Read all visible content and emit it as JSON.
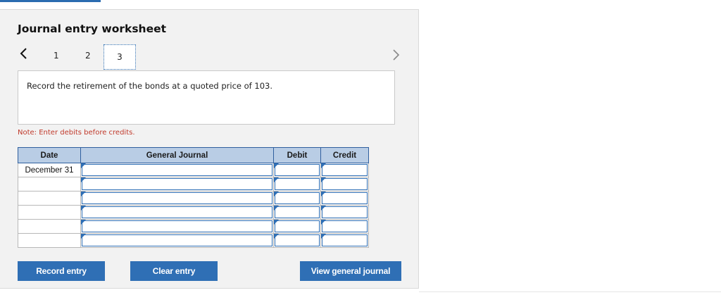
{
  "title": "Journal entry worksheet",
  "pagination": {
    "pages": [
      "1",
      "2",
      "3"
    ],
    "current": "3"
  },
  "instruction": "Record the retirement of the bonds at a quoted price of 103.",
  "note": "Note: Enter debits before credits.",
  "table": {
    "headers": {
      "date": "Date",
      "journal": "General Journal",
      "debit": "Debit",
      "credit": "Credit"
    },
    "rows": [
      {
        "date": "December 31",
        "journal": "",
        "debit": "",
        "credit": ""
      },
      {
        "date": "",
        "journal": "",
        "debit": "",
        "credit": ""
      },
      {
        "date": "",
        "journal": "",
        "debit": "",
        "credit": ""
      },
      {
        "date": "",
        "journal": "",
        "debit": "",
        "credit": ""
      },
      {
        "date": "",
        "journal": "",
        "debit": "",
        "credit": ""
      },
      {
        "date": "",
        "journal": "",
        "debit": "",
        "credit": ""
      }
    ]
  },
  "buttons": {
    "record": "Record entry",
    "clear": "Clear entry",
    "view": "View general journal"
  },
  "icons": {
    "prev": "chevron-left-icon",
    "next": "chevron-right-icon"
  },
  "colors": {
    "accent": "#2f6fb5",
    "header_bg": "#b9cde5",
    "note": "#c0392b"
  }
}
